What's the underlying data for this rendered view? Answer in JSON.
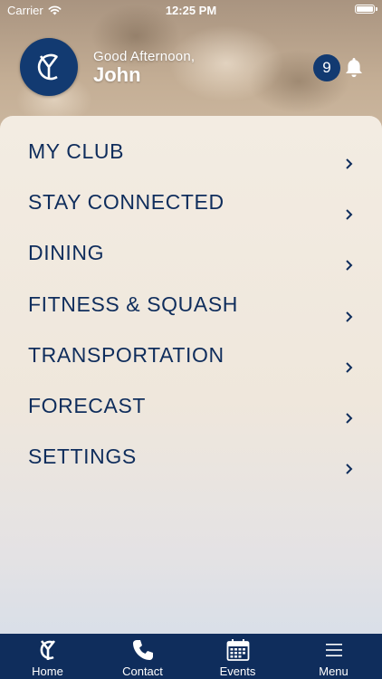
{
  "status_bar": {
    "carrier": "Carrier",
    "time": "12:25 PM"
  },
  "header": {
    "greeting": "Good Afternoon,",
    "user_name": "John",
    "notification_count": "9",
    "logo_text": "YC"
  },
  "menu": {
    "items": [
      {
        "label": "MY CLUB"
      },
      {
        "label": "STAY CONNECTED"
      },
      {
        "label": "DINING"
      },
      {
        "label": "FITNESS & SQUASH"
      },
      {
        "label": "TRANSPORTATION"
      },
      {
        "label": "FORECAST"
      },
      {
        "label": "SETTINGS"
      }
    ]
  },
  "tab_bar": {
    "tabs": [
      {
        "label": "Home",
        "icon": "club-logo-icon"
      },
      {
        "label": "Contact",
        "icon": "phone-icon"
      },
      {
        "label": "Events",
        "icon": "calendar-icon"
      },
      {
        "label": "Menu",
        "icon": "hamburger-icon"
      }
    ]
  },
  "colors": {
    "brand_navy": "#123a71",
    "text_navy": "#0f2d5c"
  }
}
